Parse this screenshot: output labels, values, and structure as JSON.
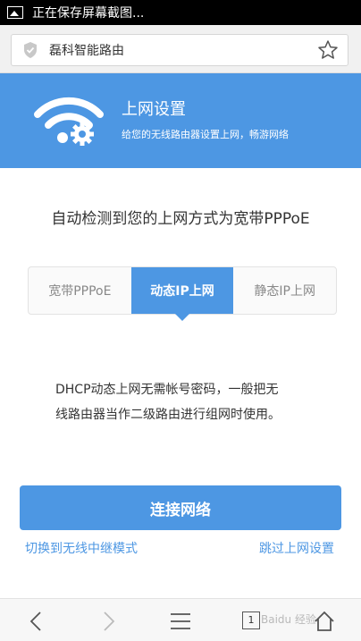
{
  "status_bar": {
    "text": "正在保存屏幕截图..."
  },
  "browser": {
    "url_title": "磊科智能路由"
  },
  "header": {
    "title": "上网设置",
    "subtitle": "给您的无线路由器设置上网，畅游网络"
  },
  "detect_text": "自动检测到您的上网方式为宽带PPPoE",
  "tabs": [
    {
      "label": "宽带PPPoE",
      "active": false
    },
    {
      "label": "动态IP上网",
      "active": true
    },
    {
      "label": "静态IP上网",
      "active": false
    }
  ],
  "description": {
    "line1": "DHCP动态上网无需帐号密码，一般把无",
    "line2": "线路由器当作二级路由进行组网时使用。"
  },
  "connect_label": "连接网络",
  "links": {
    "relay_mode": "切换到无线中继模式",
    "skip_setup": "跳过上网设置"
  },
  "bottom_bar": {
    "tab_count": "1",
    "watermark": "Baidu 经验"
  },
  "colors": {
    "accent": "#4d97e3"
  }
}
